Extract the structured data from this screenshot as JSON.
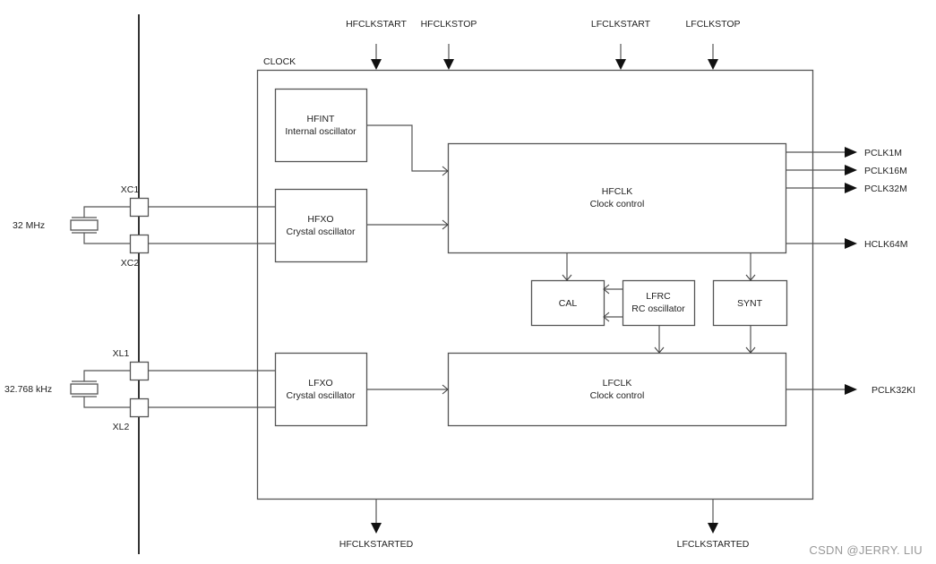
{
  "diagram": {
    "container_label": "CLOCK",
    "inputs_top": [
      "HFCLKSTART",
      "HFCLKSTOP",
      "LFCLKSTART",
      "LFCLKSTOP"
    ],
    "outputs_bottom": [
      "HFCLKSTARTED",
      "LFCLKSTARTED"
    ],
    "pins": {
      "xc1": "XC1",
      "xc2": "XC2",
      "xl1": "XL1",
      "xl2": "XL2"
    },
    "crystals": {
      "hf": "32 MHz",
      "lf": "32.768 kHz"
    },
    "blocks": {
      "hfint": {
        "title": "HFINT",
        "subtitle": "Internal oscillator"
      },
      "hfxo": {
        "title": "HFXO",
        "subtitle": "Crystal oscillator"
      },
      "lfxo": {
        "title": "LFXO",
        "subtitle": "Crystal oscillator"
      },
      "hfclk": {
        "title": "HFCLK",
        "subtitle": "Clock control"
      },
      "lfclk": {
        "title": "LFCLK",
        "subtitle": "Clock control"
      },
      "cal": {
        "title": "CAL"
      },
      "lfrc": {
        "title": "LFRC",
        "subtitle": "RC oscillator"
      },
      "synt": {
        "title": "SYNT"
      }
    },
    "outputs_right": {
      "pclk1m": "PCLK1M",
      "pclk16m": "PCLK16M",
      "pclk32m": "PCLK32M",
      "hclk64m": "HCLK64M",
      "pclk32ki": "PCLK32KI"
    }
  },
  "watermark": "CSDN @JERRY. LIU"
}
